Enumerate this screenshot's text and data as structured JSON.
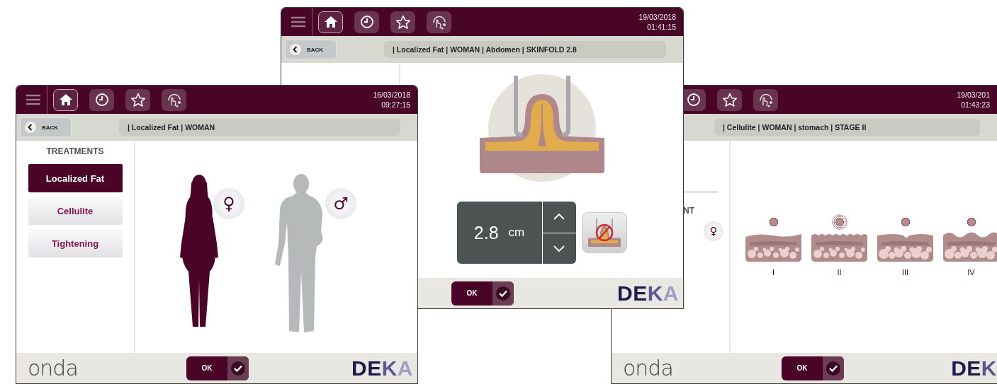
{
  "screens": [
    {
      "kind": "treatments",
      "nav": [
        {
          "selected": true
        },
        {
          "selected": false
        },
        {
          "selected": false
        },
        {
          "selected": false
        }
      ],
      "date": "16/03/2018",
      "time": "09:27:15",
      "back": "BACK",
      "breadcrumb": "| Localized Fat | WOMAN",
      "sidebar": {
        "title": "TREATMENTS",
        "items": [
          {
            "label": "Localized Fat",
            "selected": true
          },
          {
            "label": "Cellulite",
            "selected": false
          },
          {
            "label": "Tightening",
            "selected": false
          }
        ]
      },
      "genders": [
        {
          "kind": "woman",
          "symbol": "♀",
          "selected": true
        },
        {
          "kind": "man",
          "symbol": "♂",
          "selected": false
        }
      ],
      "ok": "OK",
      "brand": "onda",
      "logo": "DEKA"
    },
    {
      "kind": "skinfold",
      "nav": [
        {
          "selected": true
        },
        {
          "selected": false
        },
        {
          "selected": false
        },
        {
          "selected": false
        }
      ],
      "date": "19/03/2018",
      "time": "01:41:15",
      "back": "BACK",
      "breadcrumb": "| Localized Fat | WOMAN | Abdomen | SKINFOLD 2.8",
      "value": "2.8",
      "unit": "cm",
      "ok": "OK",
      "logo": "DEKA"
    },
    {
      "kind": "stages",
      "nav": [
        {
          "selected": false
        },
        {
          "selected": false
        },
        {
          "selected": false
        }
      ],
      "date": "19/03/201",
      "time": "01:43:23",
      "breadcrumb": "| Cellulite | WOMAN | stomach | STAGE II",
      "sidebar_label": "NT",
      "gender": "♀",
      "stages": [
        {
          "label": "I",
          "selected": false
        },
        {
          "label": "II",
          "selected": true
        },
        {
          "label": "III",
          "selected": false
        },
        {
          "label": "IV",
          "selected": false
        }
      ],
      "ok": "OK",
      "brand": "onda",
      "logo": "DEK"
    }
  ]
}
